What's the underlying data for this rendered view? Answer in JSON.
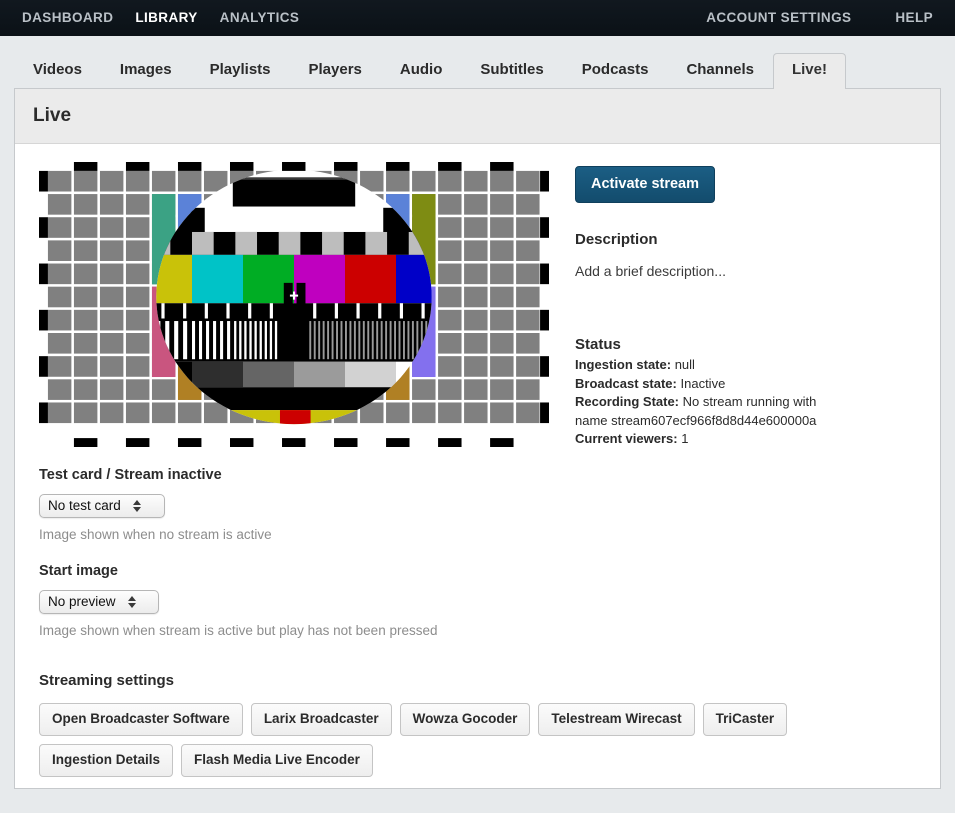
{
  "topnav": {
    "left_items": [
      {
        "label": "DASHBOARD",
        "active": false
      },
      {
        "label": "LIBRARY",
        "active": true
      },
      {
        "label": "ANALYTICS",
        "active": false
      }
    ],
    "right_items": [
      {
        "label": "ACCOUNT SETTINGS"
      },
      {
        "label": "HELP"
      }
    ]
  },
  "tabs": [
    {
      "label": "Videos",
      "active": false
    },
    {
      "label": "Images",
      "active": false
    },
    {
      "label": "Playlists",
      "active": false
    },
    {
      "label": "Players",
      "active": false
    },
    {
      "label": "Audio",
      "active": false
    },
    {
      "label": "Subtitles",
      "active": false
    },
    {
      "label": "Podcasts",
      "active": false
    },
    {
      "label": "Channels",
      "active": false
    },
    {
      "label": "Live!",
      "active": true
    }
  ],
  "panel": {
    "title": "Live"
  },
  "preview": {
    "alt": "PM5544 test card preview"
  },
  "actions": {
    "activate_stream": "Activate stream"
  },
  "description": {
    "heading": "Description",
    "text": "Add a brief description..."
  },
  "status": {
    "heading": "Status",
    "items": [
      {
        "label": "Ingestion state:",
        "value": "null"
      },
      {
        "label": "Broadcast state:",
        "value": "Inactive"
      },
      {
        "label": "Recording State:",
        "value": "No stream running with name stream607ecf966f8d8d44e600000a"
      },
      {
        "label": "Current viewers:",
        "value": "1"
      }
    ]
  },
  "test_card": {
    "label": "Test card / Stream inactive",
    "selected": "No test card",
    "options": [
      "No test card"
    ],
    "hint": "Image shown when no stream is active"
  },
  "start_image": {
    "label": "Start image",
    "selected": "No preview",
    "options": [
      "No preview"
    ],
    "hint": "Image shown when stream is active but play has not been pressed"
  },
  "streaming_settings": {
    "heading": "Streaming settings",
    "row1": [
      "Open Broadcaster Software",
      "Larix Broadcaster",
      "Wowza Gocoder",
      "Telestream Wirecast",
      "TriCaster"
    ],
    "row2": [
      "Ingestion Details",
      "Flash Media Live Encoder"
    ]
  },
  "colors": {
    "accent": "#16506f",
    "navbar": "#0d141a",
    "panel_head": "#ebebeb",
    "page_bg": "#e7eaec",
    "hint_text": "#8d8d8d"
  }
}
